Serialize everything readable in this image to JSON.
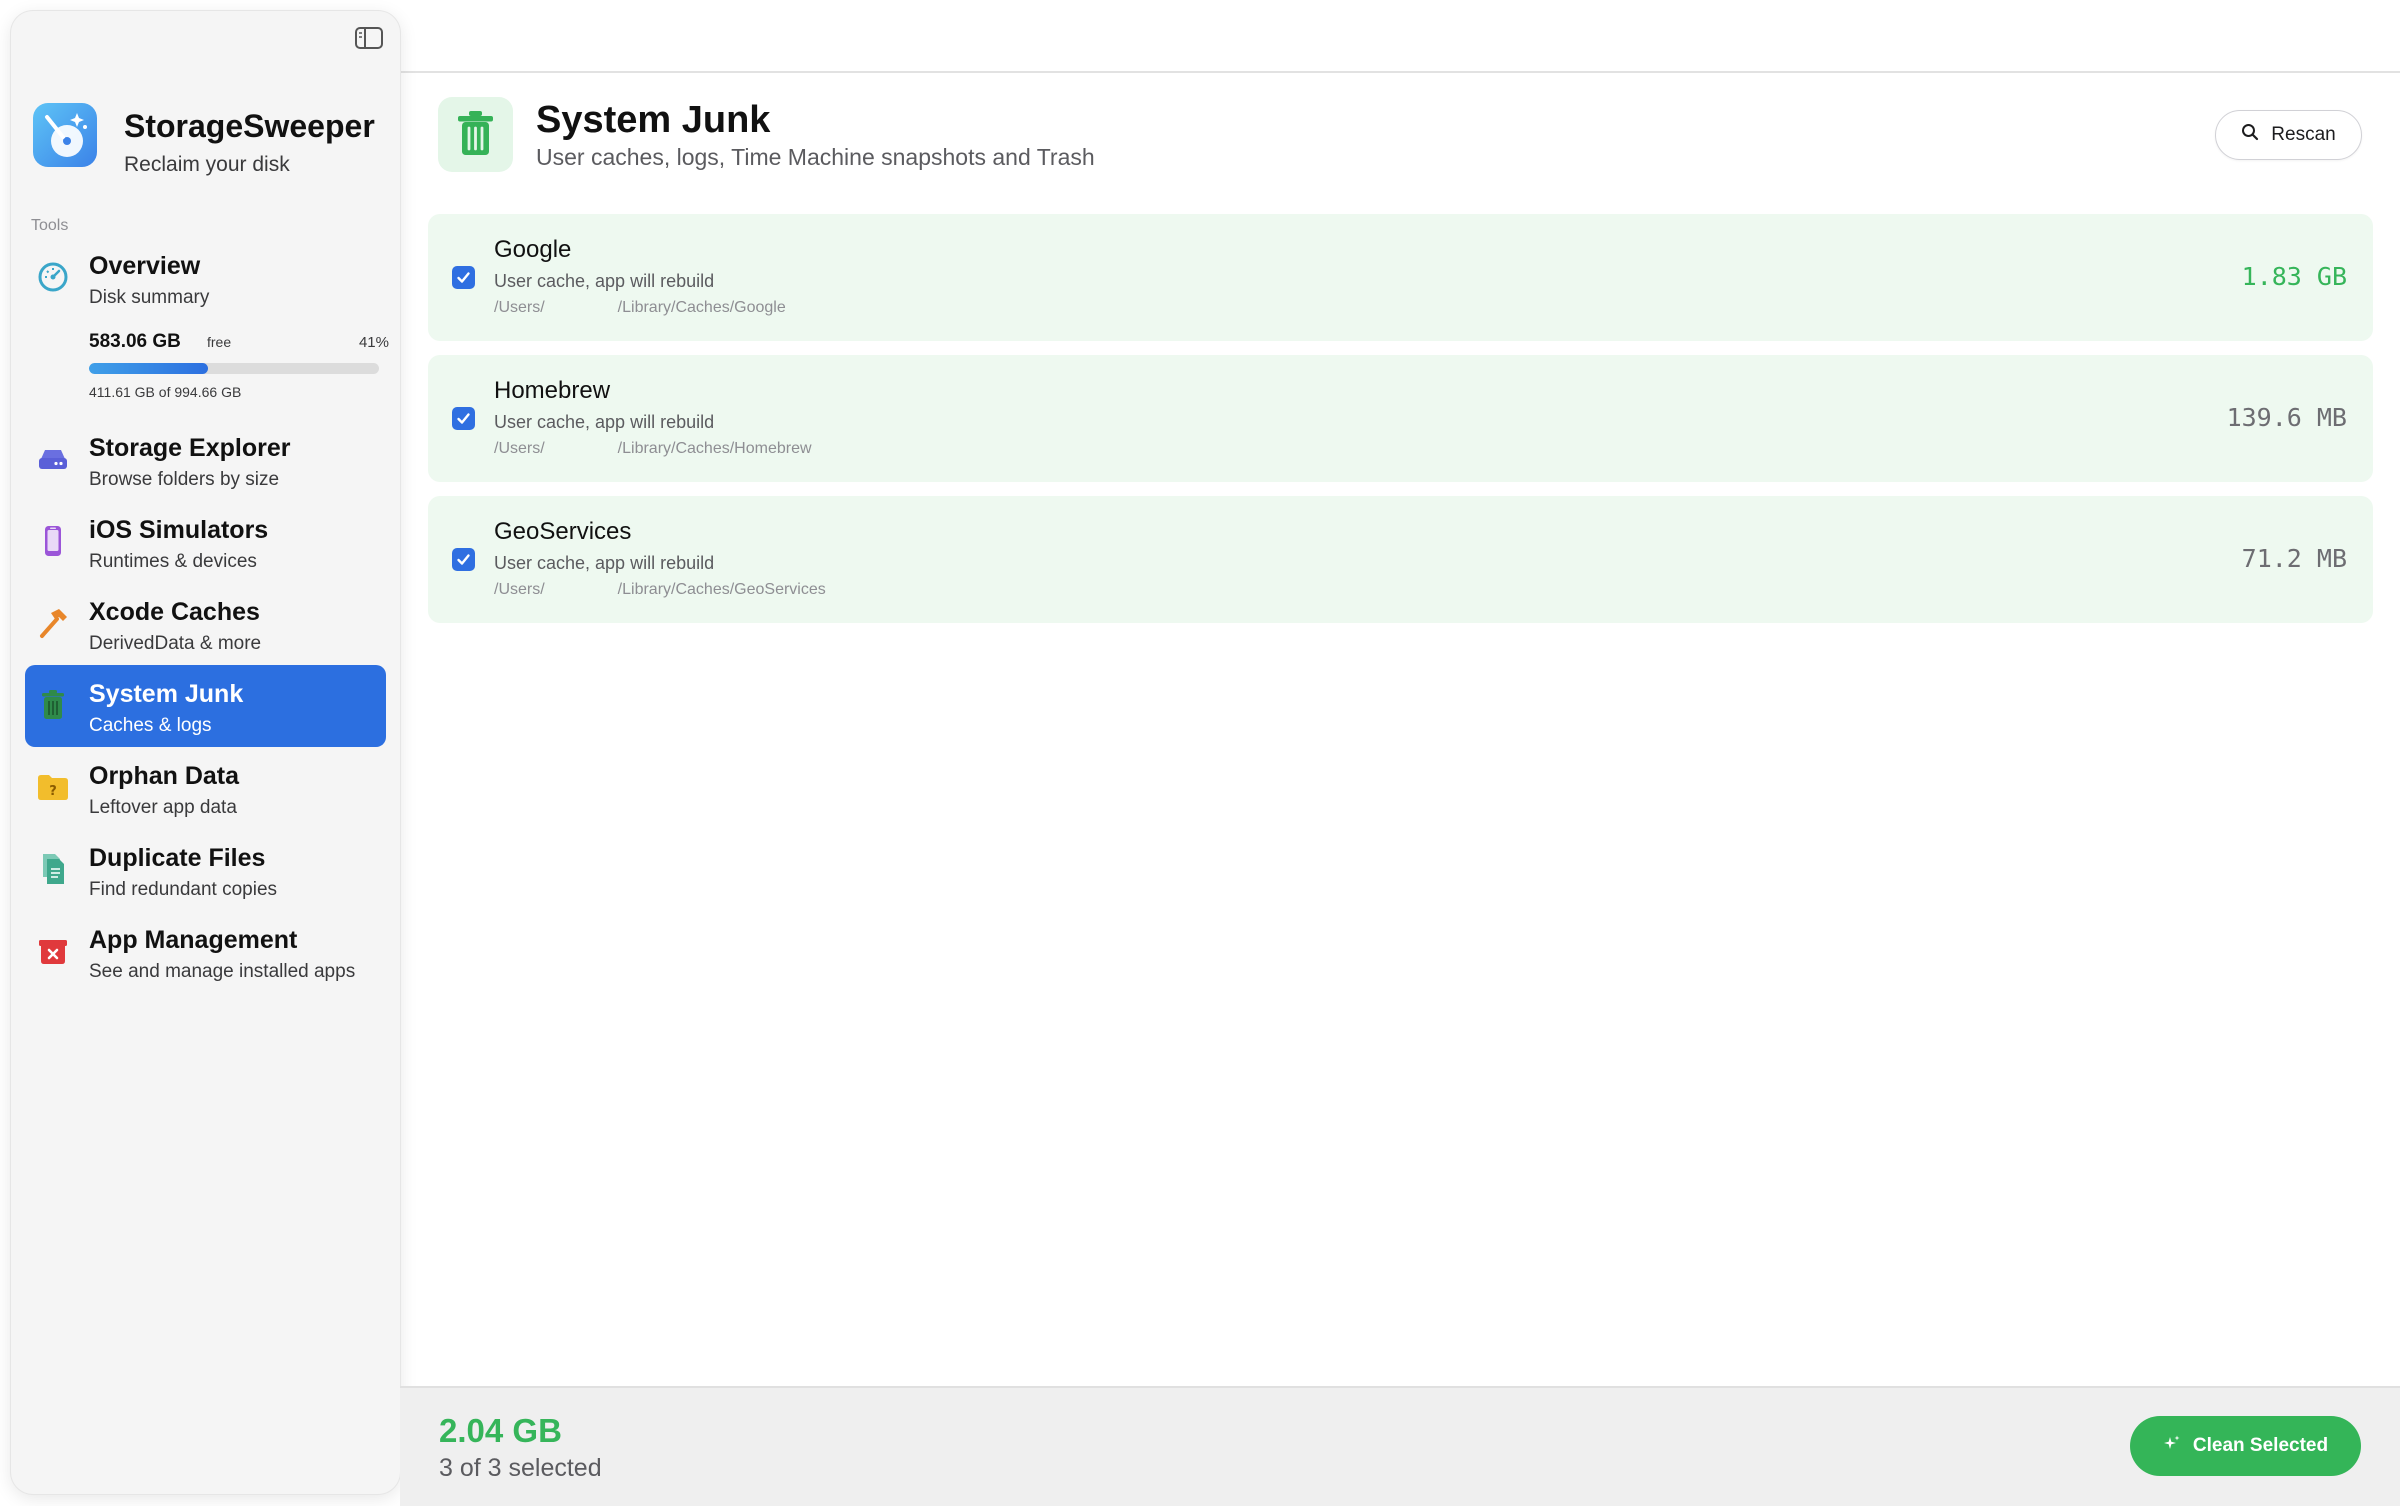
{
  "app": {
    "name": "StorageSweeper",
    "tagline": "Reclaim your disk"
  },
  "sidebar": {
    "section_label": "Tools",
    "overview": {
      "title": "Overview",
      "subtitle": "Disk summary",
      "disk": {
        "free_value": "583.06 GB",
        "free_label": "free",
        "percent": "41%",
        "used_fraction": 0.41,
        "used_text": "411.61 GB of 994.66 GB"
      }
    },
    "items": [
      {
        "id": "storage-explorer",
        "title": "Storage Explorer",
        "subtitle": "Browse folders by size",
        "icon": "drive-icon",
        "active": false
      },
      {
        "id": "ios-simulators",
        "title": "iOS Simulators",
        "subtitle": "Runtimes & devices",
        "icon": "iphone-icon",
        "active": false
      },
      {
        "id": "xcode-caches",
        "title": "Xcode Caches",
        "subtitle": "DerivedData & more",
        "icon": "hammer-icon",
        "active": false
      },
      {
        "id": "system-junk",
        "title": "System Junk",
        "subtitle": "Caches & logs",
        "icon": "trash-icon",
        "active": true
      },
      {
        "id": "orphan-data",
        "title": "Orphan Data",
        "subtitle": "Leftover app data",
        "icon": "question-folder-icon",
        "active": false
      },
      {
        "id": "duplicate-files",
        "title": "Duplicate Files",
        "subtitle": "Find redundant copies",
        "icon": "documents-icon",
        "active": false
      },
      {
        "id": "app-management",
        "title": "App Management",
        "subtitle": "See and manage installed apps",
        "icon": "delete-box-icon",
        "active": false
      }
    ]
  },
  "main": {
    "title": "System Junk",
    "subtitle": "User caches, logs, Time Machine snapshots and Trash",
    "rescan_label": "Rescan",
    "rows": [
      {
        "name": "Google",
        "description": "User cache, app will rebuild",
        "path_prefix": "/Users/",
        "path_suffix": "/Library/Caches/Google",
        "size": "1.83 GB",
        "checked": true,
        "highlight": true
      },
      {
        "name": "Homebrew",
        "description": "User cache, app will rebuild",
        "path_prefix": "/Users/",
        "path_suffix": "/Library/Caches/Homebrew",
        "size": "139.6 MB",
        "checked": true,
        "highlight": false
      },
      {
        "name": "GeoServices",
        "description": "User cache, app will rebuild",
        "path_prefix": "/Users/",
        "path_suffix": "/Library/Caches/GeoServices",
        "size": "71.2 MB",
        "checked": true,
        "highlight": false
      }
    ]
  },
  "footer": {
    "total": "2.04 GB",
    "selected_text": "3 of 3 selected",
    "clean_label": "Clean Selected"
  },
  "colors": {
    "accent": "#2c6fe0",
    "success": "#34b558",
    "row_background": "#eef9f0"
  }
}
